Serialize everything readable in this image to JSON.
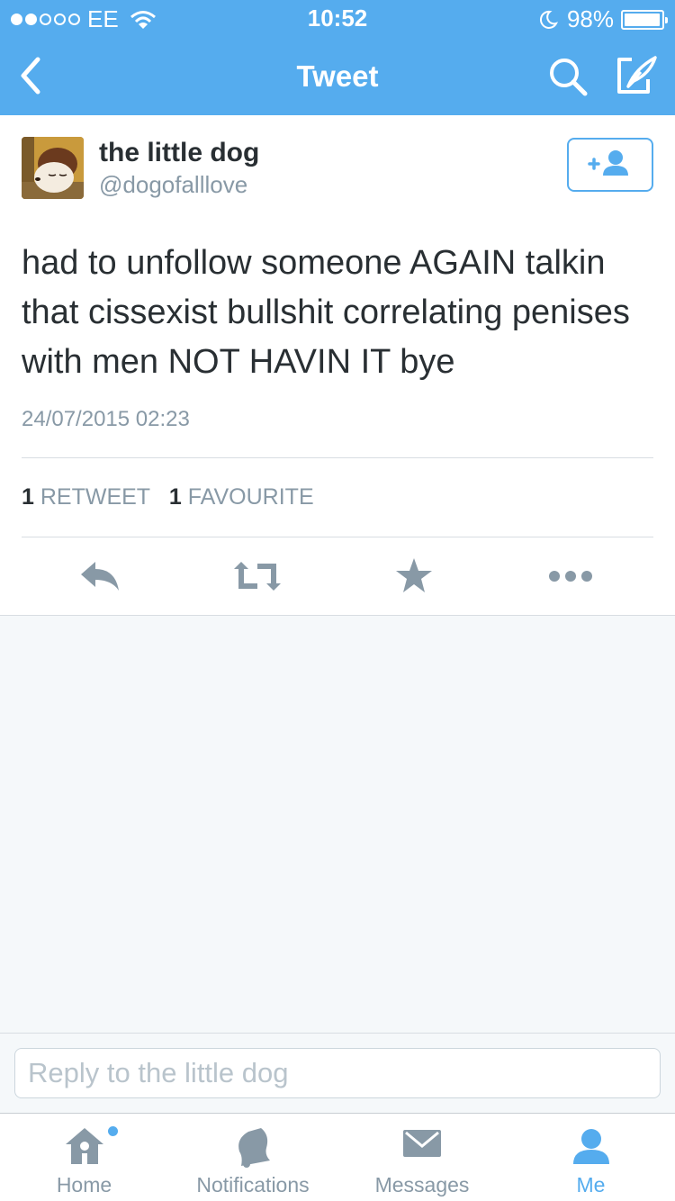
{
  "status_bar": {
    "carrier": "EE",
    "time": "10:52",
    "battery": "98%",
    "battery_level": 0.98
  },
  "nav": {
    "title": "Tweet",
    "back_icon": "chevron-left-icon",
    "search_icon": "search-icon",
    "compose_icon": "compose-icon"
  },
  "tweet": {
    "author_name": "the little dog",
    "author_handle": "@dogofalllove",
    "text": "had to unfollow someone AGAIN talkin that cissexist bullshit correlating penises with men NOT HAVIN IT bye",
    "timestamp": "24/07/2015 02:23",
    "retweet_count": "1",
    "retweet_label": "RETWEET",
    "favourite_count": "1",
    "favourite_label": "FAVOURITE",
    "follow_icon": "add-user-icon",
    "actions": [
      "reply-icon",
      "retweet-icon",
      "favourite-star-icon",
      "more-icon"
    ]
  },
  "reply": {
    "placeholder": "Reply to the little dog"
  },
  "tabbar": {
    "items": [
      {
        "label": "Home",
        "icon": "home-icon",
        "active": false,
        "has_dot": true
      },
      {
        "label": "Notifications",
        "icon": "bell-icon",
        "active": false,
        "has_dot": false
      },
      {
        "label": "Messages",
        "icon": "envelope-icon",
        "active": false,
        "has_dot": false
      },
      {
        "label": "Me",
        "icon": "person-icon",
        "active": true,
        "has_dot": false
      }
    ]
  },
  "colors": {
    "brand": "#55acee",
    "text": "#292f33",
    "muted": "#8899a6",
    "icon": "#8899a6"
  }
}
